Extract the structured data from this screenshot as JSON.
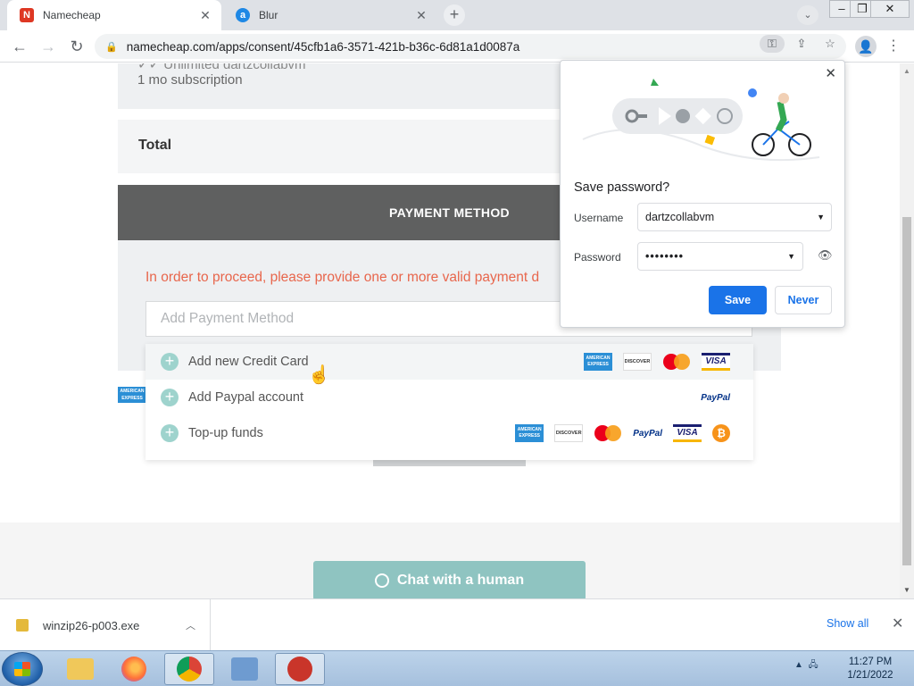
{
  "browser": {
    "tabs": [
      {
        "title": "Namecheap",
        "favicon_color": "#de3723",
        "favicon_glyph": "N"
      },
      {
        "title": "Blur",
        "favicon_color": "#1e88e5",
        "favicon_glyph": "a"
      }
    ],
    "new_tab_label": "+",
    "url": "namecheap.com/apps/consent/45cfb1a6-3571-421b-b36c-6d81a1d0087a"
  },
  "page": {
    "subscription_cut_text": "✓✓ Unlimited dartzcollabvm",
    "subscription_text": "1 mo subscription",
    "total_label": "Total",
    "payment_header": "PAYMENT METHOD",
    "error_text": "In order to proceed, please provide one or more valid payment d",
    "select_placeholder": "Add Payment Method",
    "amex_small_label": "AMERICAN EXPRESS",
    "dropdown": [
      {
        "label": "Add new Credit Card",
        "logos": [
          "amex",
          "discover",
          "mastercard",
          "visa"
        ]
      },
      {
        "label": "Add Paypal account",
        "logos": [
          "paypal"
        ]
      },
      {
        "label": "Top-up funds",
        "logos": [
          "amex",
          "discover",
          "mastercard",
          "paypal",
          "visa",
          "bitcoin"
        ]
      }
    ],
    "logo_text": {
      "amex": "AMERICAN EXPRESS",
      "discover": "DISCOVER",
      "visa": "VISA",
      "paypal": "PayPal",
      "bitcoin": "₿"
    },
    "chat_button": "Chat with a human"
  },
  "password_popup": {
    "title": "Save password?",
    "username_label": "Username",
    "username_value": "dartzcollabvm",
    "password_label": "Password",
    "password_value": "••••••••",
    "save_label": "Save",
    "never_label": "Never"
  },
  "downloads": {
    "file_name": "winzip26-p003.exe",
    "show_all": "Show all"
  },
  "taskbar": {
    "time": "11:27 PM",
    "date": "1/21/2022"
  },
  "colors": {
    "error": "#e8664c",
    "payment_header_bg": "#5f6060",
    "chat_button_bg": "#8fc4c1",
    "save_button_bg": "#1a73e8"
  }
}
